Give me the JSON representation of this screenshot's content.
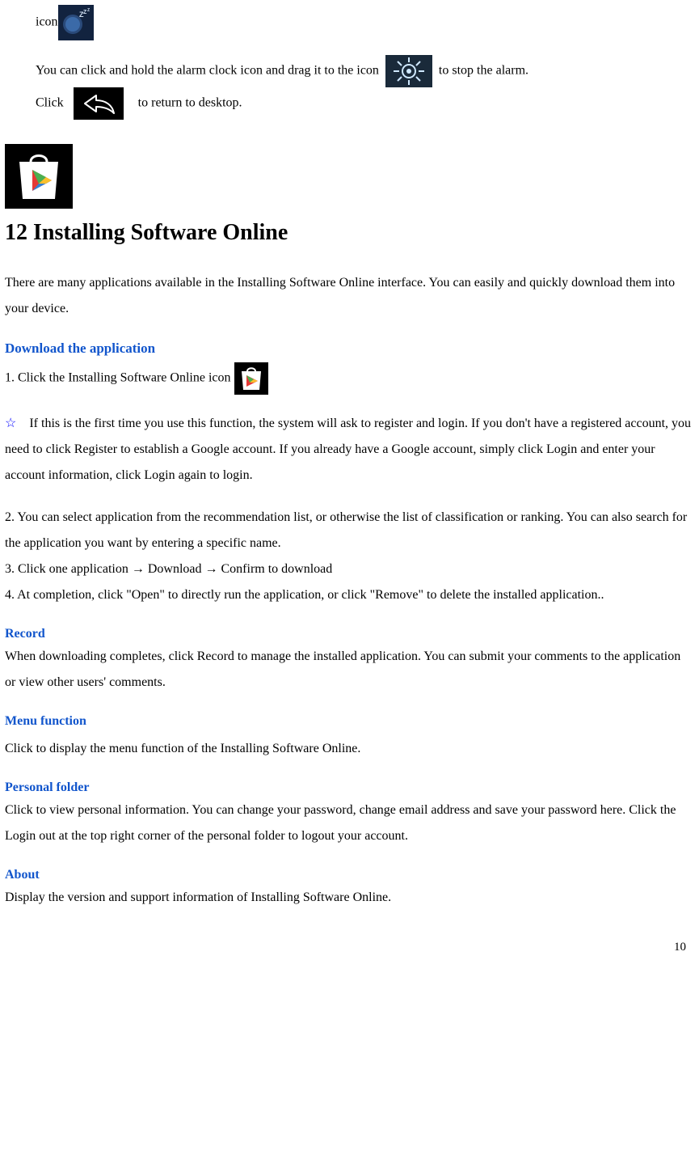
{
  "intro": {
    "icon_label": "icon",
    "line1a": "You can click and hold the alarm clock icon and drag it to the icon ",
    "line1b": " to stop the alarm.",
    "line2a": "Click ",
    "line2b": " to return to desktop."
  },
  "heading": "12 Installing Software Online",
  "intro_para": "There are many applications available in the Installing Software Online interface. You can easily and quickly download them into your device.",
  "download": {
    "heading": "Download the application",
    "step1": "1. Click the Installing Software Online icon ",
    "note": "If this is the first time you use this function, the system will ask to register and login. If you don't have a registered account, you need to click Register to establish a Google account. If you already have a Google account, simply click Login and enter your account information, click Login again to login.",
    "step2": "2. You can select application from the recommendation list, or otherwise the list of classification or ranking. You can also search for the application you want by entering a specific name.",
    "step3": "3. Click one application → Download → Confirm to download",
    "step4": "4. At completion, click \"Open\" to directly run the application, or click \"Remove\" to delete the installed application.."
  },
  "record": {
    "heading": "Record",
    "body": "When downloading completes, click Record to manage the installed application. You can submit your comments to the application or view other users' comments."
  },
  "menu": {
    "heading": "Menu function",
    "body": "Click to display the menu function of the Installing Software Online."
  },
  "personal": {
    "heading": "Personal folder",
    "body": "Click to view personal information. You can change your password, change email address and save your password here. Click the Login out at the top right corner of the personal folder to logout your account."
  },
  "about": {
    "heading": "About",
    "body": "Display the version and support information of Installing Software Online."
  },
  "page_number": "10",
  "star": "☆"
}
